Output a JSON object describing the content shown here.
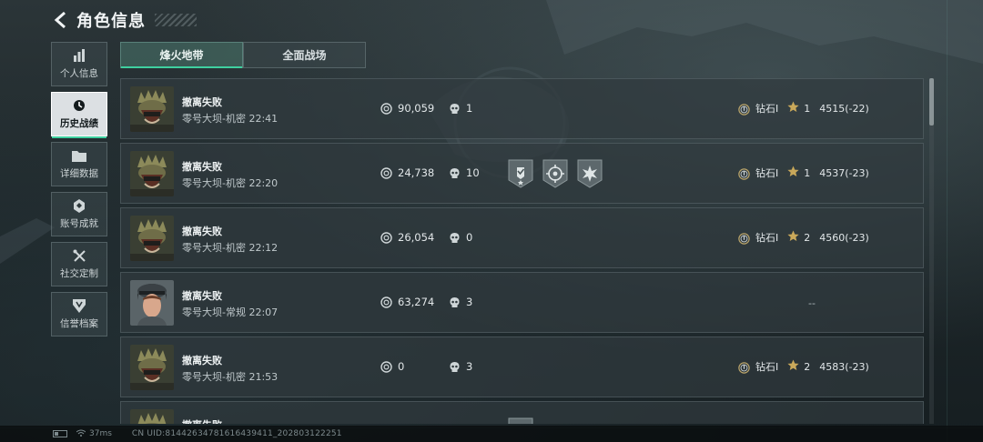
{
  "header": {
    "title": "角色信息"
  },
  "sidebar": {
    "items": [
      {
        "label": "个人信息",
        "icon": "bar-chart-icon"
      },
      {
        "label": "历史战绩",
        "icon": "clock-icon",
        "active": true
      },
      {
        "label": "详细数据",
        "icon": "folder-icon"
      },
      {
        "label": "账号成就",
        "icon": "achievement-icon"
      },
      {
        "label": "社交定制",
        "icon": "tools-icon"
      },
      {
        "label": "信誉档案",
        "icon": "shield-icon"
      }
    ]
  },
  "tabs": [
    {
      "label": "烽火地带",
      "active": true
    },
    {
      "label": "全面战场",
      "active": false
    }
  ],
  "records": [
    {
      "result": "撤离失败",
      "detail": "零号大坝-机密 22:41",
      "value": "90,059",
      "kills": "1",
      "badges": [],
      "rank": "钻石I",
      "stars": "1",
      "score": "4515(-22)",
      "avatar": "soldier-skull"
    },
    {
      "result": "撤离失败",
      "detail": "零号大坝-机密 22:20",
      "value": "24,738",
      "kills": "10",
      "badges": [
        "medal-check-icon",
        "medal-crosshair-icon",
        "medal-burst-icon"
      ],
      "rank": "钻石I",
      "stars": "1",
      "score": "4537(-23)",
      "avatar": "soldier-skull"
    },
    {
      "result": "撤离失败",
      "detail": "零号大坝-机密 22:12",
      "value": "26,054",
      "kills": "0",
      "badges": [],
      "rank": "钻石I",
      "stars": "2",
      "score": "4560(-23)",
      "avatar": "soldier-skull"
    },
    {
      "result": "撤离失败",
      "detail": "零号大坝-常规 22:07",
      "value": "63,274",
      "kills": "3",
      "badges": [],
      "rank": "--",
      "stars": "",
      "score": "",
      "avatar": "soldier-female"
    },
    {
      "result": "撤离失败",
      "detail": "零号大坝-机密 21:53",
      "value": "0",
      "kills": "3",
      "badges": [],
      "rank": "钻石I",
      "stars": "2",
      "score": "4583(-23)",
      "avatar": "soldier-skull"
    },
    {
      "result": "撤离失败",
      "detail": "",
      "value": "",
      "kills": "",
      "badges": [
        "medal-partial-icon"
      ],
      "rank": "",
      "stars": "",
      "score": "",
      "avatar": "soldier-skull"
    }
  ],
  "footer": {
    "ping": "37ms",
    "uid": "CN UID:8144263478161643941​1_202803122251"
  },
  "colors": {
    "accent": "#3fd0a0",
    "row_bg": "#303a3e"
  }
}
